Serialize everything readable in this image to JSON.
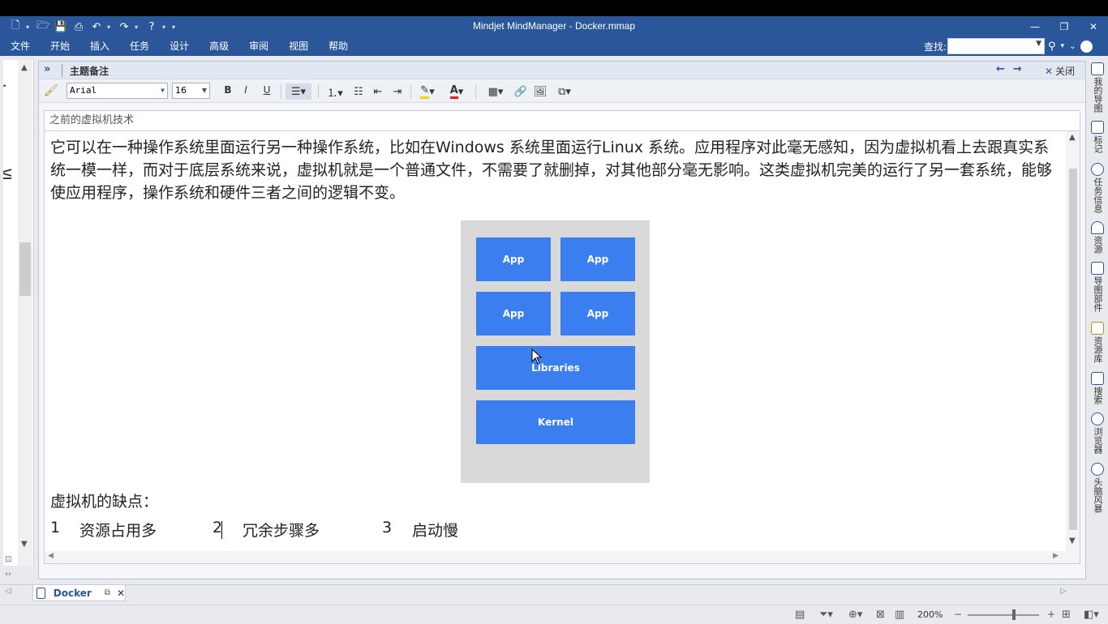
{
  "window": {
    "title": "Mindjet MindManager - Docker.mmap"
  },
  "menu": {
    "items": [
      "文件",
      "开始",
      "插入",
      "任务",
      "设计",
      "高级",
      "审阅",
      "视图",
      "帮助"
    ],
    "search_label": "查找:"
  },
  "notes_panel": {
    "title": "主题备注",
    "close_label": "关闭",
    "font_name": "Arial",
    "font_size": "16",
    "topic_title": "之前的虚拟机技术",
    "paragraph": "它可以在一种操作系统里面运行另一种操作系统，比如在Windows 系统里面运行Linux 系统。应用程序对此毫无感知，因为虚拟机看上去跟真实系统一模一样，而对于底层系统来说，虚拟机就是一个普通文件，不需要了就删掉，对其他部分毫无影响。这类虚拟机完美的运行了另一套系统，能够使应用程序，操作系统和硬件三者之间的逻辑不变。",
    "diagram": {
      "app1": "App",
      "app2": "App",
      "app3": "App",
      "app4": "App",
      "libraries": "Libraries",
      "kernel": "Kernel"
    },
    "cons_title": "虚拟机的缺点：",
    "cons": [
      {
        "num": "1",
        "text": "资源占用多"
      },
      {
        "num": "2",
        "text": "冗余步骤多"
      },
      {
        "num": "3",
        "text": "启动慢"
      }
    ]
  },
  "task_pane": [
    "我的导图",
    "标记",
    "任务信息",
    "资源",
    "导图部件",
    "资源库",
    "搜索",
    "浏览器",
    "头脑风暴"
  ],
  "doc_tab": {
    "name": "Docker"
  },
  "status": {
    "zoom": "200%"
  },
  "colors": {
    "title_bar": "#2b579a",
    "diagram_block": "#3a7eef",
    "diagram_bg": "#d9d9d9"
  }
}
